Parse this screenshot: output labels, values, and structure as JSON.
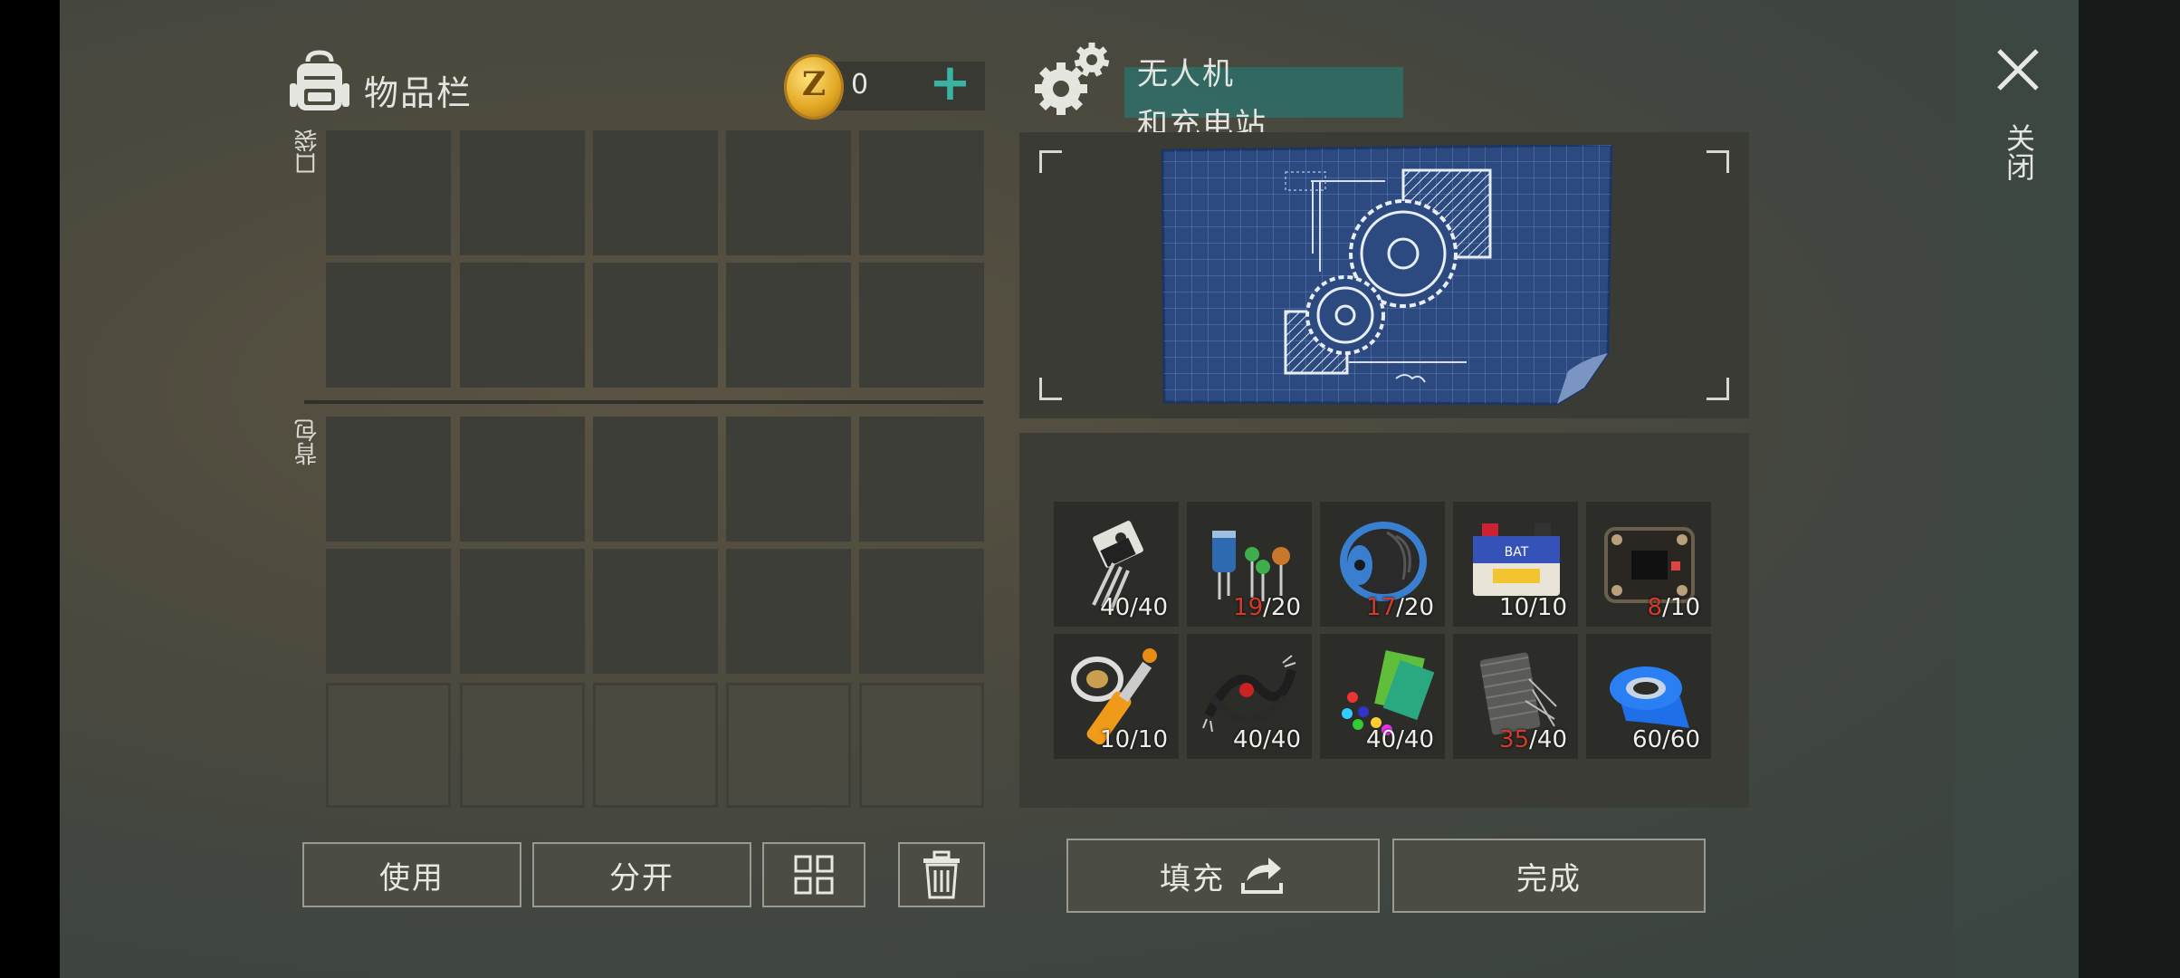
{
  "inventory": {
    "title": "物品栏",
    "coins": "0",
    "coin_symbol": "Z",
    "plus_label": "+",
    "sections": [
      {
        "label": "口袋",
        "rows": 2
      },
      {
        "label": "背包",
        "rows": 3,
        "locked_last_row": true
      }
    ],
    "columns": 5
  },
  "actions": {
    "use_label": "使用",
    "split_label": "分开",
    "sort_icon": "grid-sort-icon",
    "trash_icon": "trash-icon"
  },
  "craft": {
    "title_line1": "无人机",
    "title_line2": "和充电站",
    "blueprint_icon": "gear-blueprint",
    "fill_label": "填充",
    "fill_icon": "fill-arrow-icon",
    "done_label": "完成"
  },
  "close": {
    "label": "关闭",
    "icon": "close-icon"
  },
  "materials": [
    {
      "name": "transistor",
      "have": "40",
      "need": "40",
      "low": false
    },
    {
      "name": "capacitors",
      "have": "19",
      "need": "20",
      "low": true
    },
    {
      "name": "wire-spool",
      "have": "17",
      "need": "20",
      "low": true
    },
    {
      "name": "battery",
      "have": "10",
      "need": "10",
      "low": false
    },
    {
      "name": "circuit-board",
      "have": "8",
      "need": "10",
      "low": true
    },
    {
      "name": "hydraulic-cylinder",
      "have": "10",
      "need": "10",
      "low": false
    },
    {
      "name": "cable",
      "have": "40",
      "need": "40",
      "low": false
    },
    {
      "name": "plastic",
      "have": "40",
      "need": "40",
      "low": false
    },
    {
      "name": "fiber-mesh",
      "have": "35",
      "need": "40",
      "low": true
    },
    {
      "name": "duct-tape",
      "have": "60",
      "need": "60",
      "low": false
    }
  ],
  "colors": {
    "accent": "#3ab4a2",
    "shortage": "#d23a2a",
    "title_highlight": "#2f6e68"
  }
}
